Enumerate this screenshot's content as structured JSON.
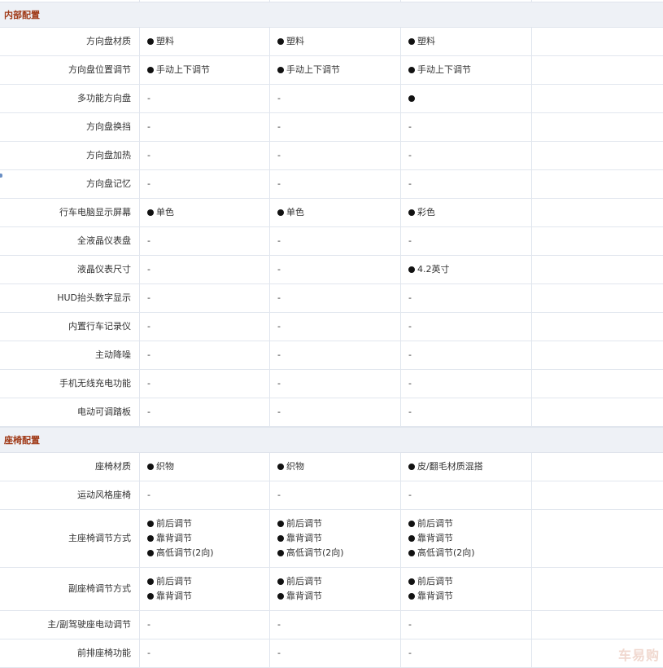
{
  "sections": [
    {
      "title": "内部配置",
      "rows": [
        {
          "label": "方向盘材质",
          "h": 35,
          "cells": [
            [
              {
                "dot": true,
                "text": "塑料"
              }
            ],
            [
              {
                "dot": true,
                "text": "塑料"
              }
            ],
            [
              {
                "dot": true,
                "text": "塑料"
              }
            ],
            []
          ]
        },
        {
          "label": "方向盘位置调节",
          "h": 35,
          "cells": [
            [
              {
                "dot": true,
                "text": "手动上下调节"
              }
            ],
            [
              {
                "dot": true,
                "text": "手动上下调节"
              }
            ],
            [
              {
                "dot": true,
                "text": "手动上下调节"
              }
            ],
            []
          ]
        },
        {
          "label": "多功能方向盘",
          "h": 35,
          "cells": [
            [
              {
                "dot": false,
                "text": "-"
              }
            ],
            [
              {
                "dot": false,
                "text": "-"
              }
            ],
            [
              {
                "dot": true,
                "text": ""
              }
            ],
            []
          ]
        },
        {
          "label": "方向盘换挡",
          "h": 35,
          "cells": [
            [
              {
                "dot": false,
                "text": "-"
              }
            ],
            [
              {
                "dot": false,
                "text": "-"
              }
            ],
            [
              {
                "dot": false,
                "text": "-"
              }
            ],
            []
          ]
        },
        {
          "label": "方向盘加热",
          "h": 35,
          "cells": [
            [
              {
                "dot": false,
                "text": "-"
              }
            ],
            [
              {
                "dot": false,
                "text": "-"
              }
            ],
            [
              {
                "dot": false,
                "text": "-"
              }
            ],
            []
          ]
        },
        {
          "label": "方向盘记忆",
          "h": 35,
          "cells": [
            [
              {
                "dot": false,
                "text": "-"
              }
            ],
            [
              {
                "dot": false,
                "text": "-"
              }
            ],
            [
              {
                "dot": false,
                "text": "-"
              }
            ],
            []
          ]
        },
        {
          "label": "行车电脑显示屏幕",
          "h": 35,
          "cells": [
            [
              {
                "dot": true,
                "text": "单色"
              }
            ],
            [
              {
                "dot": true,
                "text": "单色"
              }
            ],
            [
              {
                "dot": true,
                "text": "彩色"
              }
            ],
            []
          ]
        },
        {
          "label": "全液晶仪表盘",
          "h": 35,
          "cells": [
            [
              {
                "dot": false,
                "text": "-"
              }
            ],
            [
              {
                "dot": false,
                "text": "-"
              }
            ],
            [
              {
                "dot": false,
                "text": "-"
              }
            ],
            []
          ]
        },
        {
          "label": "液晶仪表尺寸",
          "h": 35,
          "cells": [
            [
              {
                "dot": false,
                "text": "-"
              }
            ],
            [
              {
                "dot": false,
                "text": "-"
              }
            ],
            [
              {
                "dot": true,
                "text": "4.2英寸"
              }
            ],
            []
          ]
        },
        {
          "label": "HUD抬头数字显示",
          "h": 35,
          "cells": [
            [
              {
                "dot": false,
                "text": "-"
              }
            ],
            [
              {
                "dot": false,
                "text": "-"
              }
            ],
            [
              {
                "dot": false,
                "text": "-"
              }
            ],
            []
          ]
        },
        {
          "label": "内置行车记录仪",
          "h": 35,
          "cells": [
            [
              {
                "dot": false,
                "text": "-"
              }
            ],
            [
              {
                "dot": false,
                "text": "-"
              }
            ],
            [
              {
                "dot": false,
                "text": "-"
              }
            ],
            []
          ]
        },
        {
          "label": "主动降噪",
          "h": 35,
          "cells": [
            [
              {
                "dot": false,
                "text": "-"
              }
            ],
            [
              {
                "dot": false,
                "text": "-"
              }
            ],
            [
              {
                "dot": false,
                "text": "-"
              }
            ],
            []
          ]
        },
        {
          "label": "手机无线充电功能",
          "h": 35,
          "cells": [
            [
              {
                "dot": false,
                "text": "-"
              }
            ],
            [
              {
                "dot": false,
                "text": "-"
              }
            ],
            [
              {
                "dot": false,
                "text": "-"
              }
            ],
            []
          ]
        },
        {
          "label": "电动可调踏板",
          "h": 35,
          "cells": [
            [
              {
                "dot": false,
                "text": "-"
              }
            ],
            [
              {
                "dot": false,
                "text": "-"
              }
            ],
            [
              {
                "dot": false,
                "text": "-"
              }
            ],
            []
          ]
        }
      ]
    },
    {
      "title": "座椅配置",
      "rows": [
        {
          "label": "座椅材质",
          "h": 35,
          "cells": [
            [
              {
                "dot": true,
                "text": "织物"
              }
            ],
            [
              {
                "dot": true,
                "text": "织物"
              }
            ],
            [
              {
                "dot": true,
                "text": "皮/翻毛材质混搭"
              }
            ],
            []
          ]
        },
        {
          "label": "运动风格座椅",
          "h": 35,
          "cells": [
            [
              {
                "dot": false,
                "text": "-"
              }
            ],
            [
              {
                "dot": false,
                "text": "-"
              }
            ],
            [
              {
                "dot": false,
                "text": "-"
              }
            ],
            []
          ]
        },
        {
          "label": "主座椅调节方式",
          "h": 71,
          "cells": [
            [
              {
                "dot": true,
                "text": "前后调节"
              },
              {
                "dot": true,
                "text": "靠背调节"
              },
              {
                "dot": true,
                "text": "高低调节(2向)"
              }
            ],
            [
              {
                "dot": true,
                "text": "前后调节"
              },
              {
                "dot": true,
                "text": "靠背调节"
              },
              {
                "dot": true,
                "text": "高低调节(2向)"
              }
            ],
            [
              {
                "dot": true,
                "text": "前后调节"
              },
              {
                "dot": true,
                "text": "靠背调节"
              },
              {
                "dot": true,
                "text": "高低调节(2向)"
              }
            ],
            []
          ]
        },
        {
          "label": "副座椅调节方式",
          "h": 53,
          "cells": [
            [
              {
                "dot": true,
                "text": "前后调节"
              },
              {
                "dot": true,
                "text": "靠背调节"
              }
            ],
            [
              {
                "dot": true,
                "text": "前后调节"
              },
              {
                "dot": true,
                "text": "靠背调节"
              }
            ],
            [
              {
                "dot": true,
                "text": "前后调节"
              },
              {
                "dot": true,
                "text": "靠背调节"
              }
            ],
            []
          ]
        },
        {
          "label": "主/副驾驶座电动调节",
          "h": 35,
          "cells": [
            [
              {
                "dot": false,
                "text": "-"
              }
            ],
            [
              {
                "dot": false,
                "text": "-"
              }
            ],
            [
              {
                "dot": false,
                "text": "-"
              }
            ],
            []
          ]
        },
        {
          "label": "前排座椅功能",
          "h": 35,
          "cells": [
            [
              {
                "dot": false,
                "text": "-"
              }
            ],
            [
              {
                "dot": false,
                "text": "-"
              }
            ],
            [
              {
                "dot": false,
                "text": "-"
              }
            ],
            []
          ]
        }
      ]
    }
  ],
  "watermark": "车易购"
}
